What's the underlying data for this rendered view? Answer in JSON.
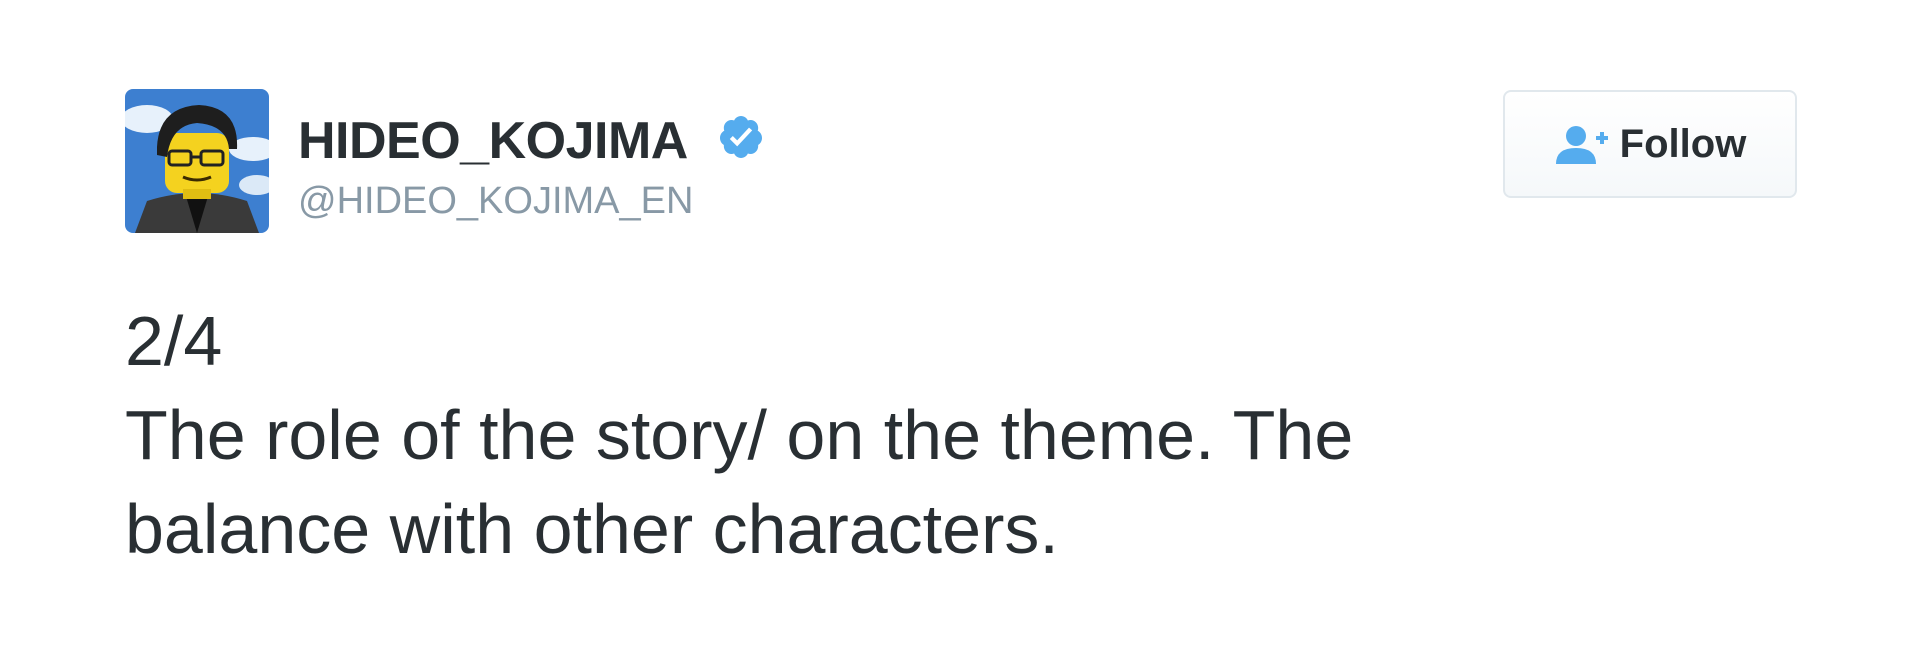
{
  "author": {
    "display_name": "HIDEO_KOJIMA",
    "handle": "@HIDEO_KOJIMA_EN",
    "verified": true,
    "avatar_icon": "lego-minifigure-avatar"
  },
  "follow_button": {
    "label": "Follow",
    "icon": "add-user-icon"
  },
  "tweet": {
    "lines": [
      "2/4",
      "The role of the story/ on the theme. The",
      "balance with other characters."
    ]
  },
  "colors": {
    "verified_badge": "#55acee",
    "follow_icon": "#55acee",
    "handle_text": "#8899a6",
    "body_text": "#292f33"
  }
}
